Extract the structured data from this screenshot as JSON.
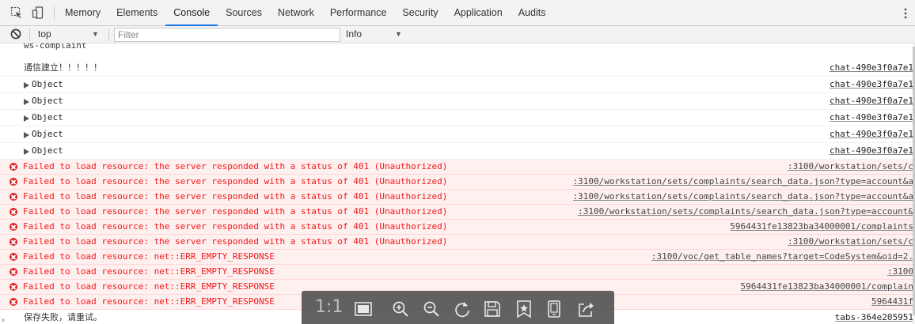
{
  "devtools": {
    "tabs": [
      {
        "label": "Memory"
      },
      {
        "label": "Elements"
      },
      {
        "label": "Console"
      },
      {
        "label": "Sources"
      },
      {
        "label": "Network"
      },
      {
        "label": "Performance"
      },
      {
        "label": "Security"
      },
      {
        "label": "Application"
      },
      {
        "label": "Audits"
      }
    ],
    "active_tab": "Console",
    "accent_color": "#1a73e8"
  },
  "filter_bar": {
    "context": "top",
    "filter_placeholder": "Filter",
    "filter_value": "",
    "level": "Info"
  },
  "console": {
    "messages": [
      {
        "type": "log",
        "text": "ws-complaint",
        "source": ""
      },
      {
        "type": "log",
        "text": "通信建立！！！！！",
        "source": "chat-490e3f0a7e1"
      },
      {
        "type": "object",
        "text": "Object",
        "source": "chat-490e3f0a7e1"
      },
      {
        "type": "object",
        "text": "Object",
        "source": "chat-490e3f0a7e1"
      },
      {
        "type": "object",
        "text": "Object",
        "source": "chat-490e3f0a7e1"
      },
      {
        "type": "object",
        "text": "Object",
        "source": "chat-490e3f0a7e1"
      },
      {
        "type": "object",
        "text": "Object",
        "source": "chat-490e3f0a7e1"
      },
      {
        "type": "error",
        "text": "Failed to load resource: the server responded with a status of 401 (Unauthorized)",
        "source": ":3100/workstation/sets/c"
      },
      {
        "type": "error",
        "text": "Failed to load resource: the server responded with a status of 401 (Unauthorized)",
        "source": ":3100/workstation/sets/complaints/search_data.json?type=account&a"
      },
      {
        "type": "error",
        "text": "Failed to load resource: the server responded with a status of 401 (Unauthorized)",
        "source": ":3100/workstation/sets/complaints/search_data.json?type=account&a"
      },
      {
        "type": "error",
        "text": "Failed to load resource: the server responded with a status of 401 (Unauthorized)",
        "source": ":3100/workstation/sets/complaints/search_data.json?type=account&"
      },
      {
        "type": "error",
        "text": "Failed to load resource: the server responded with a status of 401 (Unauthorized)",
        "source": "5964431fe13823ba34000001/complaints"
      },
      {
        "type": "error",
        "text": "Failed to load resource: the server responded with a status of 401 (Unauthorized)",
        "source": ":3100/workstation/sets/c"
      },
      {
        "type": "error",
        "text": "Failed to load resource: net::ERR_EMPTY_RESPONSE",
        "source": ":3100/voc/get_table_names?target=CodeSystem&oid=2."
      },
      {
        "type": "error",
        "text": "Failed to load resource: net::ERR_EMPTY_RESPONSE",
        "source": ":3100"
      },
      {
        "type": "error",
        "text": "Failed to load resource: net::ERR_EMPTY_RESPONSE",
        "source": "5964431fe13823ba34000001/complain"
      },
      {
        "type": "error",
        "text": "Failed to load resource: net::ERR_EMPTY_RESPONSE",
        "source": "5964431f"
      },
      {
        "type": "log",
        "text": "保存失败，请重试。",
        "source": "tabs-364e205951"
      }
    ],
    "error_color": "#f01818",
    "error_background": "#fff0f0"
  },
  "image_viewer": {
    "ratio_label": "1:1",
    "buttons": [
      {
        "icon": "fit-screen-icon"
      },
      {
        "icon": "zoom-in-icon"
      },
      {
        "icon": "zoom-out-icon"
      },
      {
        "icon": "rotate-icon"
      },
      {
        "icon": "save-icon"
      },
      {
        "icon": "bookmark-star-icon"
      },
      {
        "icon": "device-icon"
      },
      {
        "icon": "share-icon"
      }
    ]
  }
}
